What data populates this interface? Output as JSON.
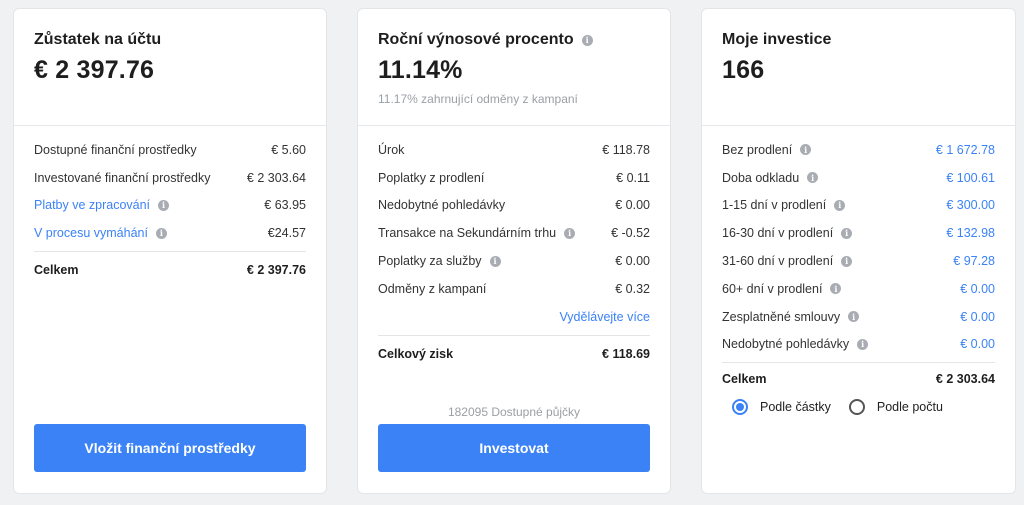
{
  "balance": {
    "title": "Zůstatek na účtu",
    "amount": "€ 2 397.76",
    "rows": [
      {
        "label": "Dostupné finanční prostředky",
        "value": "€ 5.60"
      },
      {
        "label": "Investované finanční prostředky",
        "value": "€ 2 303.64"
      },
      {
        "label": "Platby ve zpracování",
        "value": "€ 63.95"
      },
      {
        "label": "V procesu vymáhání",
        "value": "€24.57"
      }
    ],
    "total_label": "Celkem",
    "total_value": "€ 2 397.76",
    "button": "Vložit finanční prostředky"
  },
  "yield": {
    "title": "Roční výnosové procento",
    "percent": "11.14%",
    "note": "11.17% zahrnující odměny z kampaní",
    "rows": [
      {
        "label": "Úrok",
        "value": "€ 118.78"
      },
      {
        "label": "Poplatky z prodlení",
        "value": "€ 0.11"
      },
      {
        "label": "Nedobytné pohledávky",
        "value": "€ 0.00"
      },
      {
        "label": "Transakce na Sekundárním trhu",
        "value": "€ -0.52"
      },
      {
        "label": "Poplatky za služby",
        "value": "€ 0.00"
      },
      {
        "label": "Odměny z kampaní",
        "value": "€ 0.32"
      }
    ],
    "more_link": "Vydělávejte více",
    "total_label": "Celkový zisk",
    "total_value": "€ 118.69",
    "available_loans": "182095 Dostupné půjčky",
    "button": "Investovat"
  },
  "investments": {
    "title": "Moje investice",
    "count": "166",
    "rows": [
      {
        "label": "Bez prodlení",
        "value": "€ 1 672.78"
      },
      {
        "label": "Doba odkladu",
        "value": "€ 100.61"
      },
      {
        "label": "1-15 dní v prodlení",
        "value": "€ 300.00"
      },
      {
        "label": "16-30 dní v prodlení",
        "value": "€ 132.98"
      },
      {
        "label": "31-60 dní v prodlení",
        "value": "€ 97.28"
      },
      {
        "label": "60+ dní v prodlení",
        "value": "€ 0.00"
      },
      {
        "label": "Zesplatněné smlouvy",
        "value": "€ 0.00"
      },
      {
        "label": "Nedobytné pohledávky",
        "value": "€ 0.00"
      }
    ],
    "total_label": "Celkem",
    "total_value": "€ 2 303.64",
    "radio_amount": "Podle částky",
    "radio_count": "Podle počtu",
    "selected": "Podle částky"
  },
  "colors": {
    "accent": "#3b82f6",
    "background": "#f0f1f3",
    "info_icon": "#a9adb3"
  }
}
